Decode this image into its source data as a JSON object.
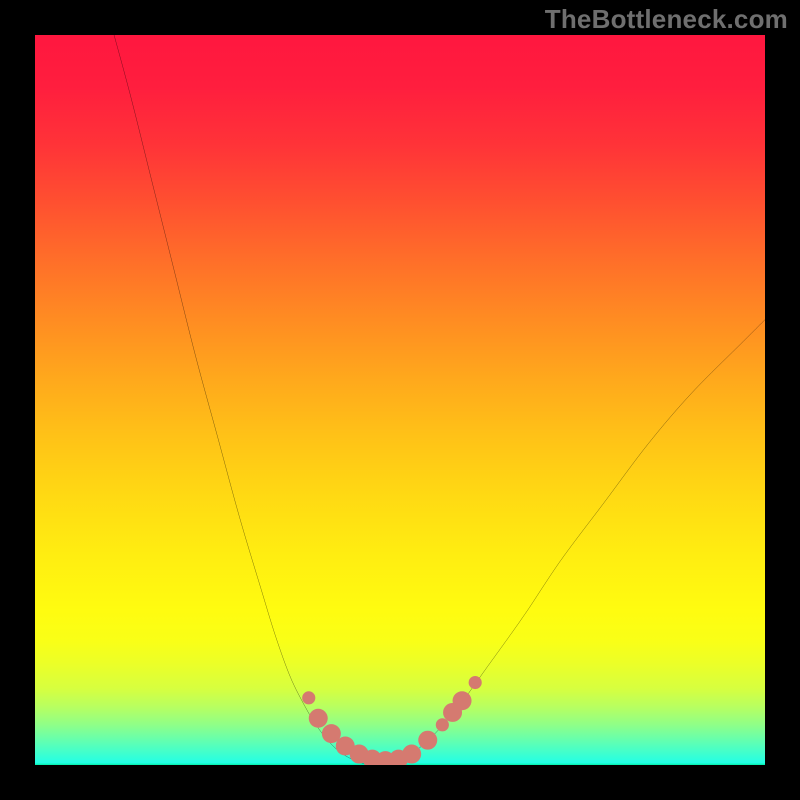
{
  "watermark": "TheBottleneck.com",
  "chart_data": {
    "type": "line",
    "title": "",
    "xlabel": "",
    "ylabel": "",
    "xlim": [
      0,
      100
    ],
    "ylim": [
      0,
      100
    ],
    "grid": false,
    "gradient_stops": [
      {
        "pct": 0,
        "color": "#ff173f"
      },
      {
        "pct": 7,
        "color": "#ff1e3e"
      },
      {
        "pct": 15,
        "color": "#ff3338"
      },
      {
        "pct": 23,
        "color": "#ff5030"
      },
      {
        "pct": 31,
        "color": "#ff6f29"
      },
      {
        "pct": 39,
        "color": "#ff8c22"
      },
      {
        "pct": 47,
        "color": "#ffa81c"
      },
      {
        "pct": 55,
        "color": "#ffc217"
      },
      {
        "pct": 63,
        "color": "#ffd913"
      },
      {
        "pct": 71,
        "color": "#ffed11"
      },
      {
        "pct": 79,
        "color": "#fffc10"
      },
      {
        "pct": 83,
        "color": "#f9ff17"
      },
      {
        "pct": 86,
        "color": "#ecff27"
      },
      {
        "pct": 89.5,
        "color": "#d7ff3f"
      },
      {
        "pct": 92,
        "color": "#b8ff60"
      },
      {
        "pct": 94.5,
        "color": "#8fff88"
      },
      {
        "pct": 97,
        "color": "#5cffb6"
      },
      {
        "pct": 99.7,
        "color": "#23ffe5"
      },
      {
        "pct": 100,
        "color": "#00f1a8"
      }
    ],
    "series": [
      {
        "name": "bottleneck-curve",
        "color": "#000000",
        "x": [
          10,
          13,
          16,
          19,
          22,
          25,
          28,
          31,
          33,
          35,
          37,
          38.5,
          40,
          41.5,
          43,
          45,
          47,
          49,
          51,
          54,
          58,
          62,
          67,
          72,
          78,
          84,
          90,
          97,
          100
        ],
        "y": [
          103,
          92,
          80,
          68,
          56,
          45,
          34,
          24,
          17.5,
          12,
          8,
          5.5,
          3.5,
          2,
          1,
          0.2,
          0,
          0.2,
          1.2,
          3.5,
          8,
          13.5,
          20.5,
          28,
          36,
          44,
          51,
          58,
          61
        ]
      }
    ],
    "markers": {
      "name": "highlight-points",
      "color": "#d57a70",
      "points": [
        {
          "x": 37.5,
          "y": 9.2,
          "r": 0.9
        },
        {
          "x": 38.8,
          "y": 6.4,
          "r": 1.3
        },
        {
          "x": 40.6,
          "y": 4.3,
          "r": 1.3
        },
        {
          "x": 42.5,
          "y": 2.6,
          "r": 1.3
        },
        {
          "x": 44.4,
          "y": 1.5,
          "r": 1.3
        },
        {
          "x": 46.2,
          "y": 0.8,
          "r": 1.3
        },
        {
          "x": 48.0,
          "y": 0.6,
          "r": 1.3
        },
        {
          "x": 49.8,
          "y": 0.8,
          "r": 1.3
        },
        {
          "x": 51.6,
          "y": 1.5,
          "r": 1.3
        },
        {
          "x": 53.8,
          "y": 3.4,
          "r": 1.3
        },
        {
          "x": 55.8,
          "y": 5.5,
          "r": 0.9
        },
        {
          "x": 57.2,
          "y": 7.2,
          "r": 1.3
        },
        {
          "x": 58.5,
          "y": 8.8,
          "r": 1.3
        },
        {
          "x": 60.3,
          "y": 11.3,
          "r": 0.9
        }
      ]
    }
  }
}
